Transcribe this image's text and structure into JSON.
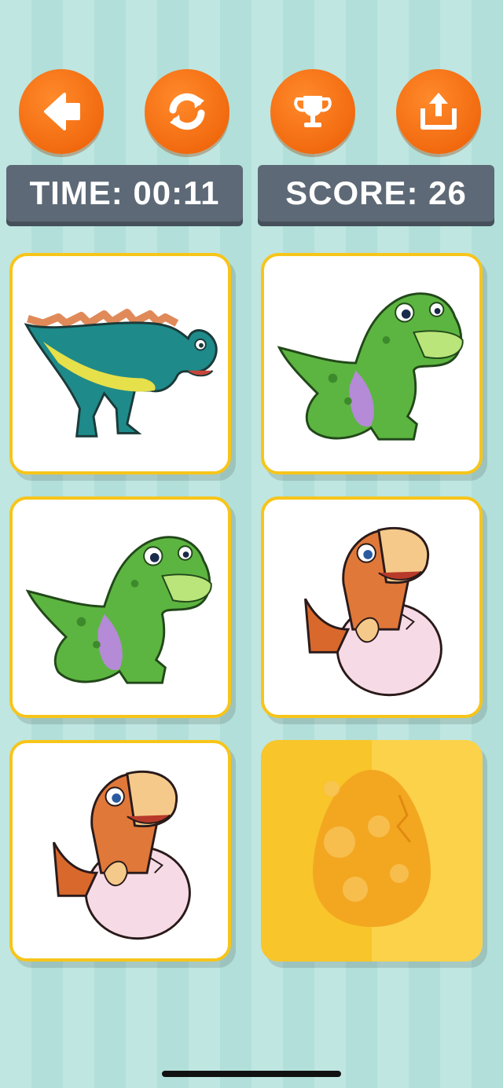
{
  "header": {
    "buttons": [
      {
        "name": "back-button",
        "icon": "arrow-left-icon"
      },
      {
        "name": "restart-button",
        "icon": "refresh-icon"
      },
      {
        "name": "trophy-button",
        "icon": "trophy-icon"
      },
      {
        "name": "share-button",
        "icon": "share-icon"
      }
    ],
    "time_text": "TIME: 00:11",
    "score_text": "SCORE: 26"
  },
  "colors": {
    "button_orange": "#f26a0f",
    "stat_panel": "#5d6976",
    "card_border": "#f7c51a",
    "card_back": "#f8c52a",
    "background_stripe_a": "#bfe6e1",
    "background_stripe_b": "#b2dfd9"
  },
  "board": {
    "cards": [
      {
        "state": "revealed",
        "picture": "teal-spiky-dinosaur"
      },
      {
        "state": "revealed",
        "picture": "green-t-rex"
      },
      {
        "state": "revealed",
        "picture": "green-t-rex"
      },
      {
        "state": "revealed",
        "picture": "orange-baby-dino-in-egg"
      },
      {
        "state": "revealed",
        "picture": "orange-baby-dino-in-egg"
      },
      {
        "state": "hidden",
        "picture": "egg-card-back"
      }
    ]
  }
}
